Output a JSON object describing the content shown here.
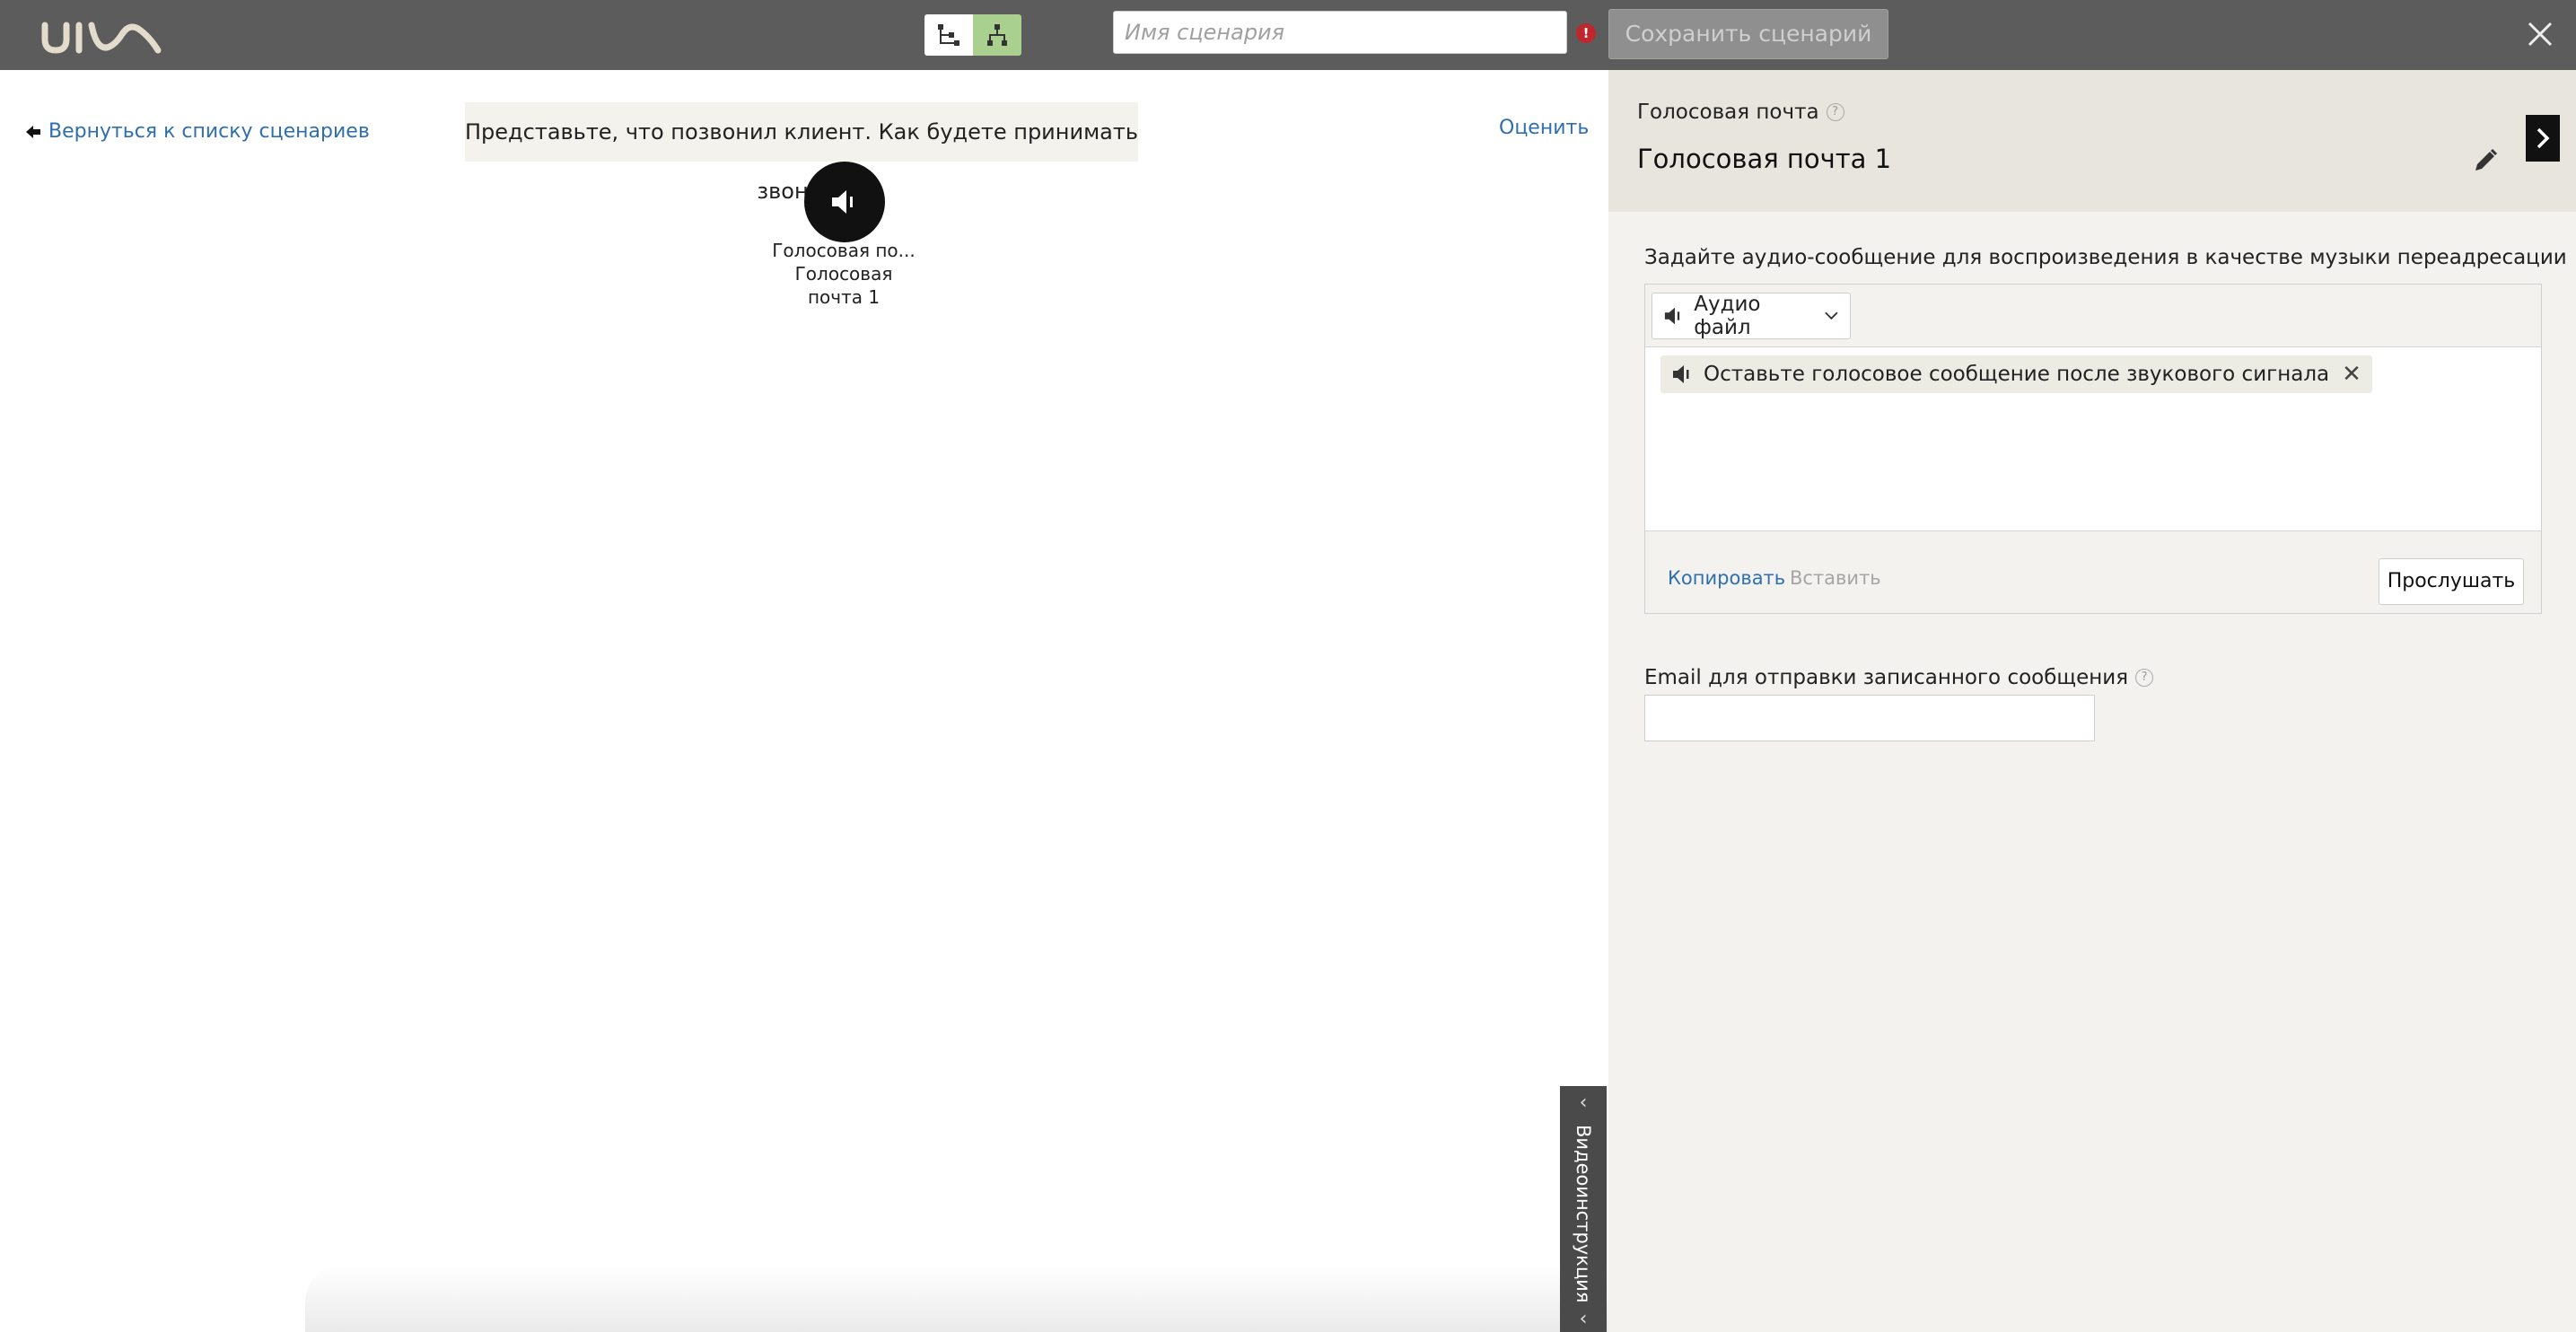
{
  "header": {
    "logo_text": "uiw",
    "scenario_name": {
      "value": "",
      "placeholder": "Имя сценария"
    },
    "warning_icon": "!",
    "save_label": "Сохранить сценарий",
    "view_modes": [
      "tree-view-icon",
      "flow-view-icon"
    ],
    "active_view": "flow-view-icon",
    "colors": {
      "bar": "#5c5c5c",
      "active_view": "#a9d08e"
    }
  },
  "canvas": {
    "back_label": "Вернуться к списку сценариев",
    "prompt": "Представьте, что позвонил клиент. Как будете принимать звонок?",
    "rate_label": "Оценить",
    "node": {
      "icon": "speaker-icon",
      "type_short": "Голосовая по...",
      "name_line1": "Голосовая",
      "name_line2": "почта 1"
    },
    "video_tab_label": "Видеоинструкция"
  },
  "panel": {
    "type_label": "Голосовая почта",
    "title": "Голосовая почта 1",
    "audio_heading": "Задайте аудио-сообщение для воспроизведения в качестве музыки переадресации",
    "audio_type": "Аудио файл",
    "audio_item": "Оставьте голосовое сообщение после звукового сигнала",
    "copy_label": "Копировать",
    "paste_label": "Вставить",
    "listen_label": "Прослушать",
    "email_label": "Email для отправки записанного сообщения",
    "email_value": "",
    "help_icon_text": "?",
    "colors": {
      "header_bg": "#e8e5de",
      "body_bg": "#f3f2ef",
      "link": "#2f6fb0"
    }
  }
}
